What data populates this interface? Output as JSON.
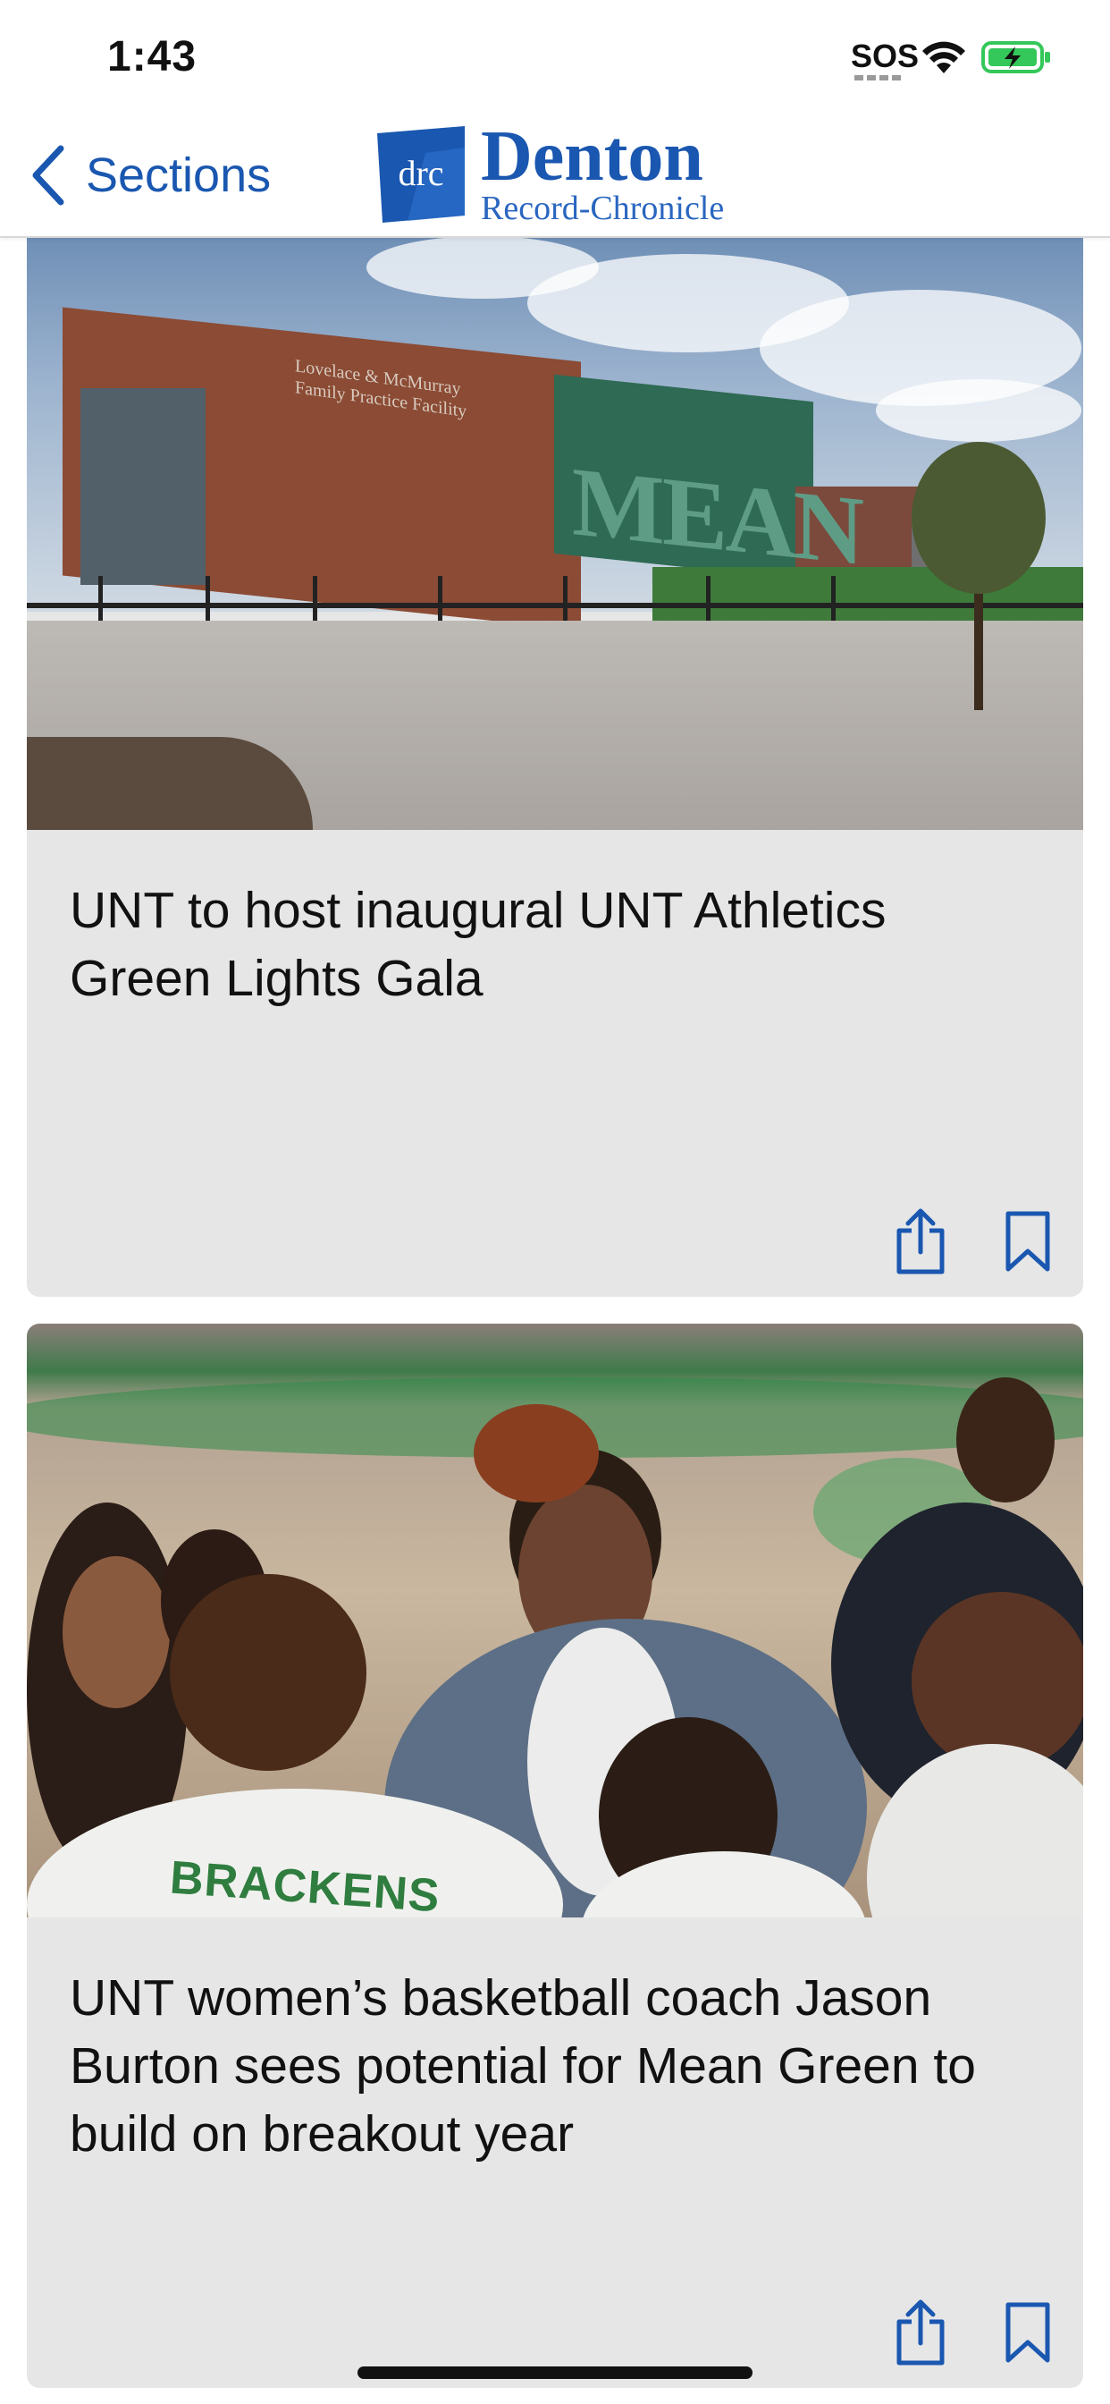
{
  "status_bar": {
    "time": "1:43",
    "signal": "SOS",
    "wifi_icon": "wifi-icon",
    "battery_icon": "battery-charging-icon",
    "battery_color": "#34c759"
  },
  "nav": {
    "back_label": "Sections",
    "back_icon": "chevron-left-icon",
    "logo_mark": "drc",
    "logo_title": "Denton",
    "logo_subtitle": "Record-Chronicle",
    "accent_color": "#1a57b0"
  },
  "feed": {
    "articles": [
      {
        "title": "UNT to host inaugural UNT Athletics Green Lights Gala",
        "image_caption_text": "MEAN",
        "building_sign": "Lovelace & McMurray Family Practice Facility",
        "actions": {
          "share_icon": "share-icon",
          "bookmark_icon": "bookmark-icon"
        }
      },
      {
        "title": "UNT women’s basketball coach Jason Burton sees potential for Mean Green to build on breakout year",
        "jersey_text": "BRACKENS",
        "actions": {
          "share_icon": "share-icon",
          "bookmark_icon": "bookmark-icon"
        }
      }
    ]
  }
}
